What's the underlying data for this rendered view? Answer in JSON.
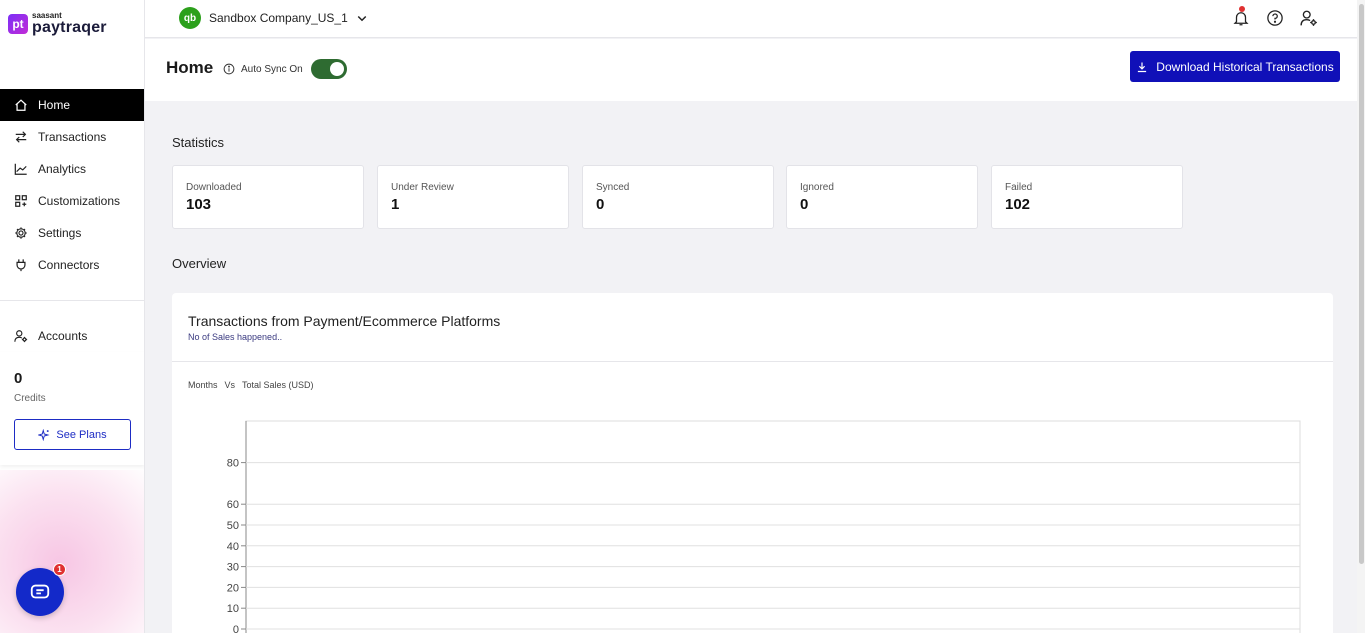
{
  "brand": {
    "small": "saasant",
    "name": "paytraqer",
    "mark": "pt"
  },
  "nav": {
    "items": [
      {
        "label": "Home",
        "icon": "home-icon",
        "active": true
      },
      {
        "label": "Transactions",
        "icon": "swap-icon"
      },
      {
        "label": "Analytics",
        "icon": "chart-line-icon"
      },
      {
        "label": "Customizations",
        "icon": "grid-icon"
      },
      {
        "label": "Settings",
        "icon": "gear-icon"
      },
      {
        "label": "Connectors",
        "icon": "plug-icon"
      }
    ],
    "accounts_label": "Accounts"
  },
  "credits": {
    "value": "0",
    "label": "Credits",
    "button_label": "See Plans"
  },
  "chat": {
    "badge": "1"
  },
  "topbar": {
    "company_icon": "qb",
    "company_name": "Sandbox Company_US_1"
  },
  "header": {
    "title": "Home",
    "autosync_label": "Auto Sync On",
    "autosync_on": true,
    "download_label": "Download Historical Transactions"
  },
  "statistics": {
    "title": "Statistics",
    "cards": [
      {
        "label": "Downloaded",
        "value": "103"
      },
      {
        "label": "Under Review",
        "value": "1"
      },
      {
        "label": "Synced",
        "value": "0"
      },
      {
        "label": "Ignored",
        "value": "0"
      },
      {
        "label": "Failed",
        "value": "102"
      }
    ]
  },
  "overview": {
    "title": "Overview",
    "chart_title": "Transactions from Payment/Ecommerce Platforms",
    "chart_subtitle": "No of Sales happened..",
    "x_axis_label": "Months",
    "vs_label": "Vs",
    "y_axis_label": "Total Sales (USD)"
  },
  "chart_data": {
    "type": "bar",
    "title": "Transactions from Payment/Ecommerce Platforms",
    "subtitle": "No of Sales happened..",
    "xlabel": "Months",
    "ylabel": "Total Sales (USD)",
    "y_ticks": [
      0,
      10,
      20,
      30,
      40,
      50,
      60,
      80
    ],
    "ylim": [
      0,
      100
    ],
    "grid": true,
    "categories": [],
    "values": []
  }
}
